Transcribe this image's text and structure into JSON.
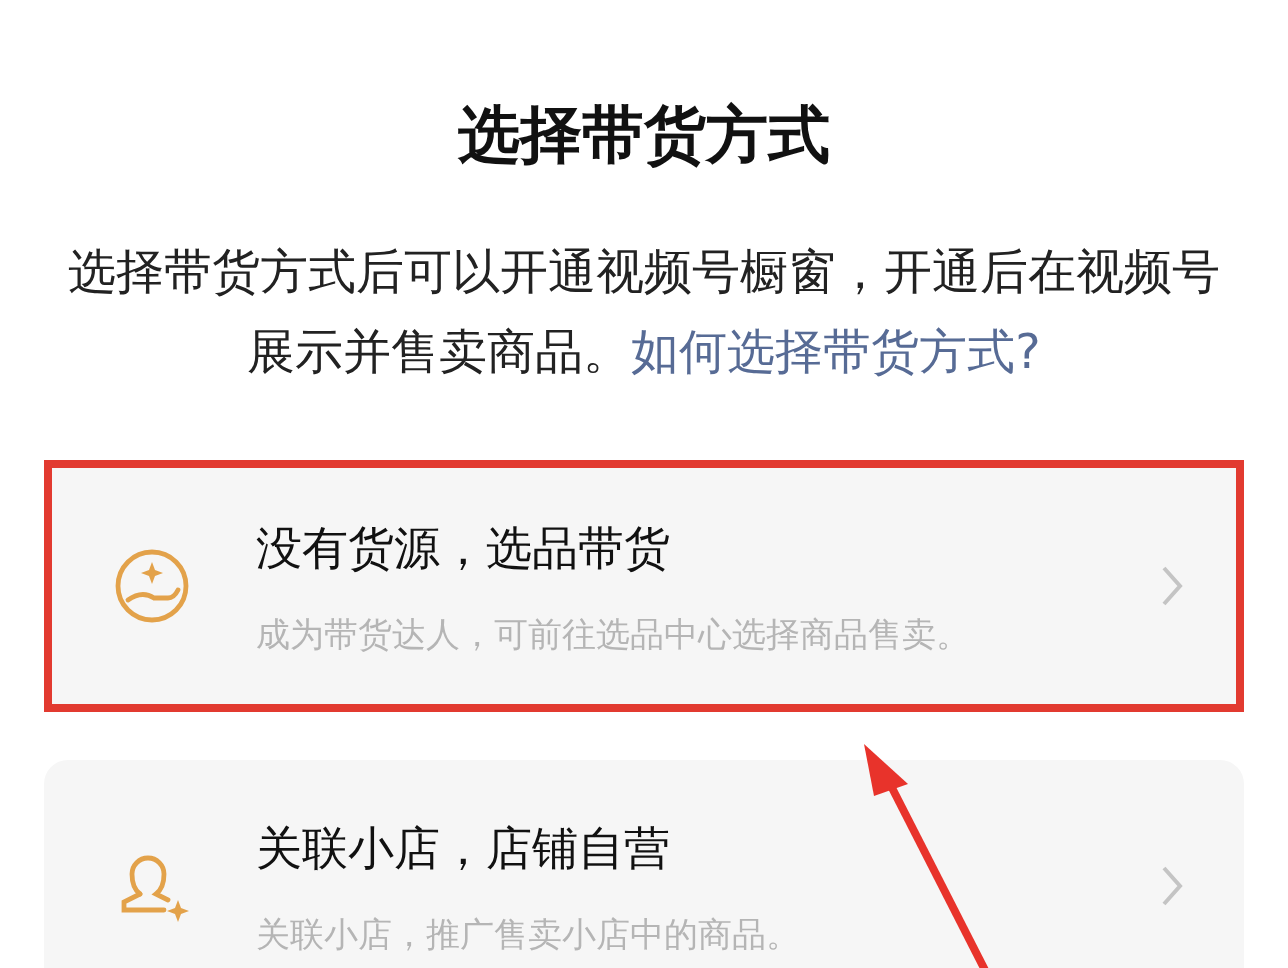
{
  "title": "选择带货方式",
  "description": {
    "text": "选择带货方式后可以开通视频号橱窗，开通后在视频号展示并售卖商品。",
    "link": "如何选择带货方式?"
  },
  "options": [
    {
      "kind": "hand",
      "title": "没有货源，选品带货",
      "subtitle": "成为带货达人，可前往选品中心选择商品售卖。",
      "highlighted": true
    },
    {
      "kind": "person",
      "title": "关联小店，店铺自营",
      "subtitle": "关联小店，推广售卖小店中的商品。",
      "highlighted": false
    }
  ]
}
